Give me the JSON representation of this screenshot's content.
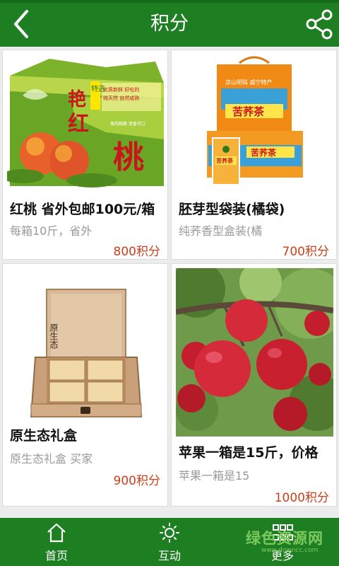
{
  "header": {
    "title": "积分",
    "back_icon": "chevron-left-icon",
    "share_icon": "share-icon",
    "color": "#1e7f22"
  },
  "products": [
    {
      "name": "红桃 省外包邮100元/箱",
      "desc": "每箱10斤，省外",
      "points": "800积分",
      "image": {
        "box_text_1": "艳",
        "box_text_2": "红",
        "box_text_3": "桃",
        "badge": "特选",
        "tagline_1": "优质新鲜 好吃的",
        "tagline_2": "纯天然 自然成熟",
        "tagline_3": "果肉细嫩 清香可口"
      }
    },
    {
      "name": "胚芽型袋装(橘袋)",
      "desc": "纯荞香型盒装(橘",
      "points": "700积分",
      "image": {
        "brand": "苦荞茶",
        "slogan": "凉山明珠 威宁特产"
      }
    },
    {
      "name": "原生态礼盒",
      "desc": "原生态礼盒 买家",
      "points": "900积分",
      "image": {
        "box_label": "原生态"
      }
    },
    {
      "name": "苹果一箱是15斤，价格",
      "desc": "苹果一箱是15",
      "points": "1000积分"
    }
  ],
  "nav": [
    {
      "label": "首页",
      "icon": "home-icon"
    },
    {
      "label": "互动",
      "icon": "sun-icon"
    },
    {
      "label": "更多",
      "icon": "grid-icon"
    }
  ],
  "watermark": {
    "text": "绿色资源网",
    "url": "www.downcc.com"
  },
  "colors": {
    "points": "#c8411b",
    "nav_bg": "#1e7f22"
  }
}
